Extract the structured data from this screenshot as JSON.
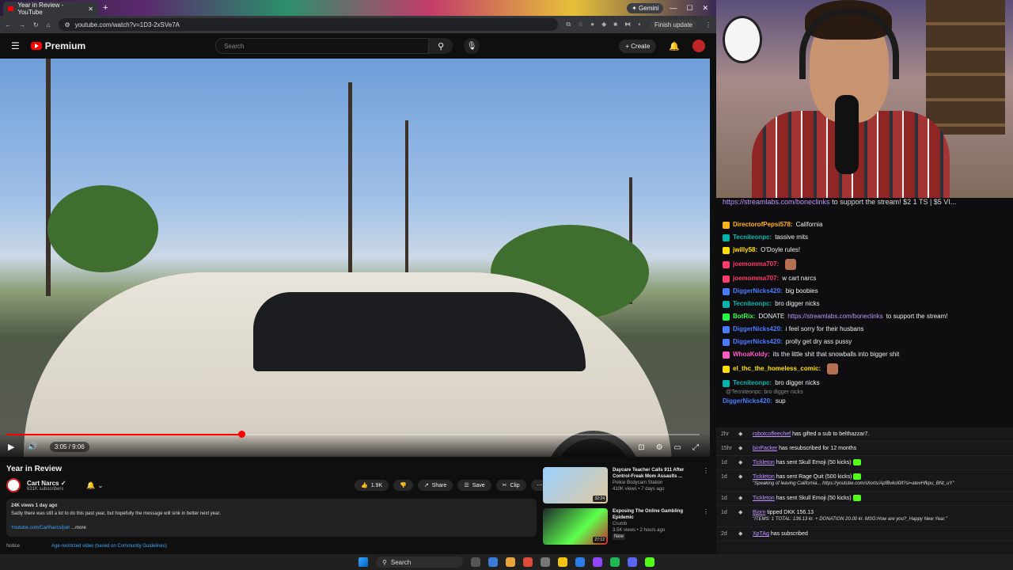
{
  "browser": {
    "tab_title": "Year in Review - YouTube",
    "gemini_label": "Gemini",
    "url": "youtube.com/watch?v=1D3-2xSVe7A",
    "finish_update": "Finish update"
  },
  "youtube": {
    "logo_text": "Premium",
    "search_placeholder": "Search",
    "create_label": "Create",
    "player": {
      "time": "3:05 / 9:06",
      "progress_fraction": 0.339
    },
    "video": {
      "title": "Year in Review",
      "channel": "Cart Narcs",
      "subscribers": "631K subscribers",
      "likes": "1.9K",
      "share": "Share",
      "save": "Save",
      "clip": "Clip",
      "views_date": "24K views  1 day ago",
      "description": "Sadly there was still a lot to do this past year, but hopefully the message will sink in better next year.",
      "desc_link": "Youtube.com/CartNarcs/join",
      "more": "...more",
      "notice_label": "Notice",
      "notice_link": "Age-restricted video (based on Community Guidelines)"
    },
    "recommendations": [
      {
        "title": "Daycare Teacher Calls 911 After Control-Freak Mom Assaults ...",
        "channel": "Police Bodycam Station",
        "meta": "410K views • 7 days ago",
        "duration": "32:24",
        "new": ""
      },
      {
        "title": "Exposing The Online Gambling Epidemic",
        "channel": "Crumb",
        "meta": "3.5K views • 2 hours ago",
        "duration": "27:12",
        "new": "New"
      }
    ]
  },
  "chat": {
    "top_banner_link": "https://streamlabs.com/boneclinks",
    "top_banner_text": " to support the stream! $2 1 TS | $5 VI...",
    "messages": [
      {
        "user": "DirectorofPepsi578:",
        "color": "#ffb31a",
        "msg": " California"
      },
      {
        "user": "Tecniteonpc:",
        "color": "#00b5ad",
        "msg": " tassive mits"
      },
      {
        "user": "jwilly58:",
        "color": "#ffe000",
        "msg": " O'Doyle rules!"
      },
      {
        "user": "joemomma707:",
        "color": "#ff3b6b",
        "msg": ""
      },
      {
        "user": "joemomma707:",
        "color": "#ff3b6b",
        "msg": " w cart narcs"
      },
      {
        "user": "DiggerNicks420:",
        "color": "#4b7bff",
        "msg": " big boobies"
      },
      {
        "user": "Tecniteonpc:",
        "color": "#00b5ad",
        "msg": " bro digger nicks"
      },
      {
        "user": "BotRix:",
        "color": "#22ff44",
        "msg": " DONATE ",
        "link": "https://streamlabs.com/boneclinks",
        "after": " to support the stream!"
      },
      {
        "user": "DiggerNicks420:",
        "color": "#4b7bff",
        "msg": " i feel sorry for their husbans"
      },
      {
        "user": "DiggerNicks420:",
        "color": "#4b7bff",
        "msg": " prolly get dry ass pussy"
      },
      {
        "user": "WhoaKoldy:",
        "color": "#ff59c2",
        "msg": " its the little shit that snowballs into bigger shit"
      },
      {
        "user": "el_thc_the_homeless_comic:",
        "color": "#ffe000",
        "msg": ""
      },
      {
        "user": "Tecniteonpc:",
        "color": "#00b5ad",
        "msg": " bro digger nicks"
      }
    ],
    "reply_context": "@Tecniteonpc: bro digger nicks",
    "last": {
      "user": "DiggerNicks420:",
      "msg": " sup"
    }
  },
  "events": [
    {
      "time": "2hr",
      "user": "robotcoffeechef",
      "text": " has gifted a sub to belthazzar7.",
      "quote": ""
    },
    {
      "time": "15hr",
      "user": "binPacker",
      "text": " has resubscribed for 12 months",
      "quote": ""
    },
    {
      "time": "1d",
      "user": "Tickleton",
      "text": " has sent Skull Emoji (50 kicks)",
      "quote": ""
    },
    {
      "time": "1d",
      "user": "Tickleton",
      "text": " has sent Rage Quit (500 kicks)",
      "quote": "\"Speaking of leaving California... https://youtube.com/shorts/ApfBvkol0lI?si=atevHfkpu_BNt_uY\""
    },
    {
      "time": "1d",
      "user": "Tickleton",
      "text": " has sent Skull Emoji (50 kicks)",
      "quote": ""
    },
    {
      "time": "1d",
      "user": "Bjorn",
      "text": " tipped DKK 156.13",
      "quote": "\"ITEMS: 1 TOTAL: 136.13 kr. + DONATION 20.00 kr. MSG:How are you?_Happy New Year.\""
    },
    {
      "time": "2d",
      "user": "XpTAg",
      "text": " has subscribed",
      "quote": ""
    }
  ],
  "taskbar": {
    "search": "Search"
  }
}
